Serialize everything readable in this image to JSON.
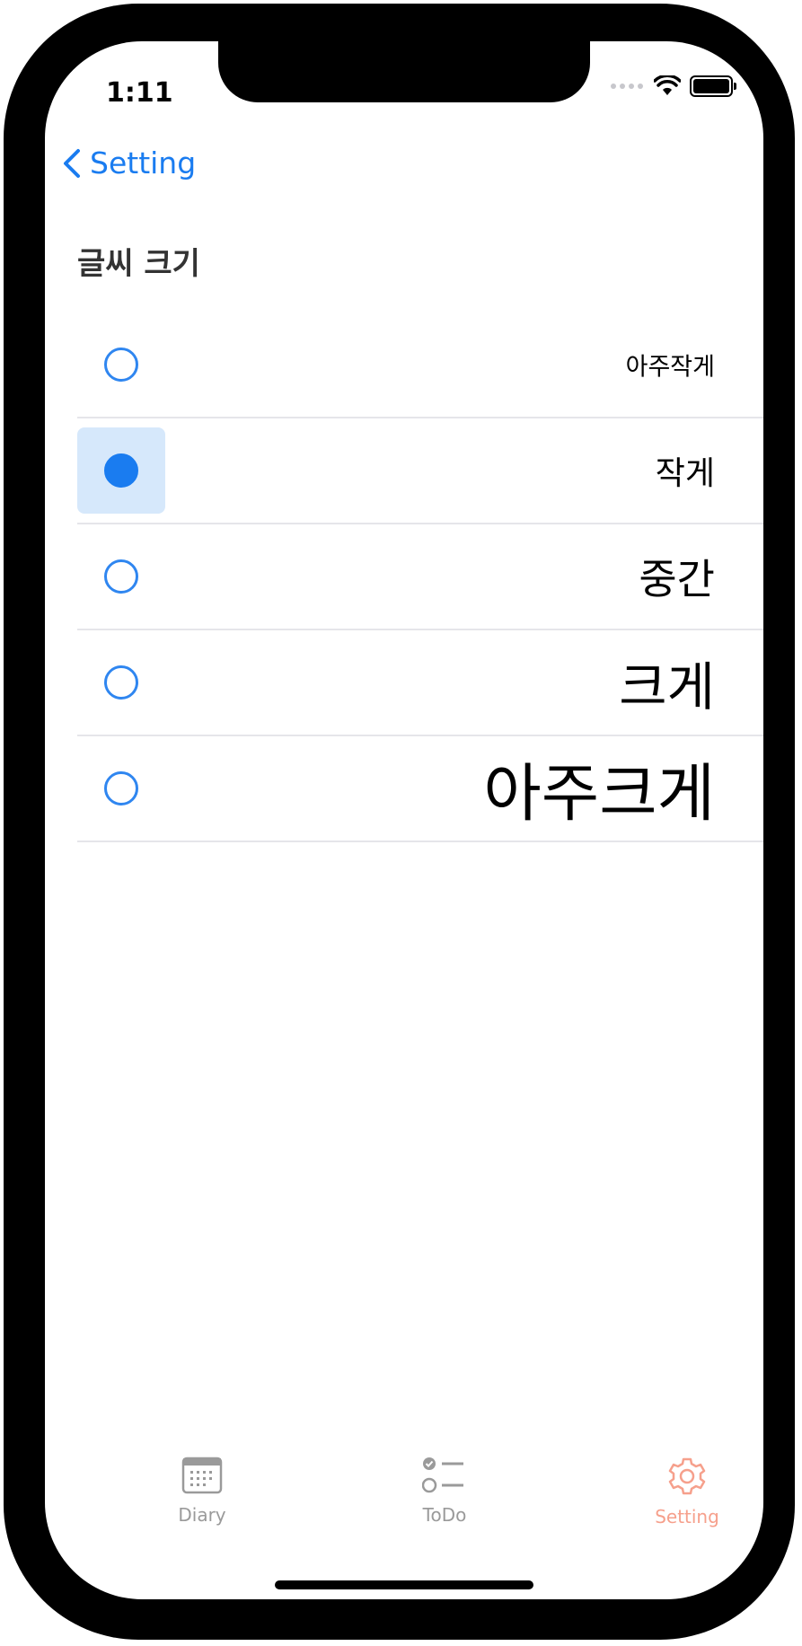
{
  "status_bar": {
    "time": "1:11"
  },
  "nav": {
    "back_label": "Setting"
  },
  "section": {
    "title": "글씨 크기"
  },
  "font_size_options": [
    {
      "label": "아주작게",
      "selected": false
    },
    {
      "label": "작게",
      "selected": true
    },
    {
      "label": "중간",
      "selected": false
    },
    {
      "label": "크게",
      "selected": false
    },
    {
      "label": "아주크게",
      "selected": false
    }
  ],
  "tab_bar": {
    "items": [
      {
        "label": "Diary",
        "icon": "calendar-icon",
        "active": false
      },
      {
        "label": "ToDo",
        "icon": "checklist-icon",
        "active": false
      },
      {
        "label": "Setting",
        "icon": "gear-icon",
        "active": true
      }
    ]
  },
  "colors": {
    "accent": "#1a7cf0",
    "selected_bg": "#d6e8fb",
    "tab_active": "#f6a08c",
    "tab_inactive": "#9a9a9a"
  }
}
